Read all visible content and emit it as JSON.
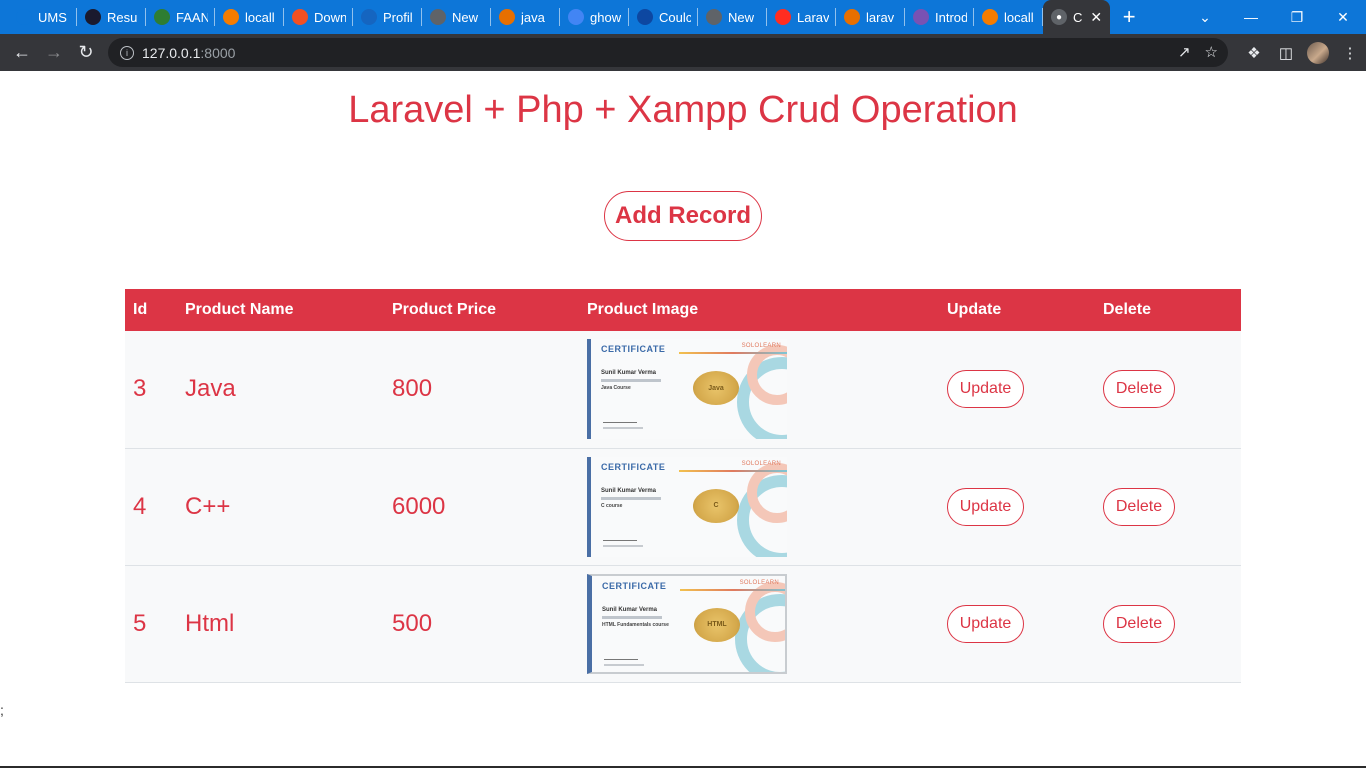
{
  "browser": {
    "tabs": [
      {
        "title": "UMS",
        "icon": "globe-icon",
        "color": "#0d76d8"
      },
      {
        "title": "Resu",
        "icon": "r-logo-icon",
        "color": "#1a1a2e"
      },
      {
        "title": "FAAN",
        "icon": "leaf-icon",
        "color": "#2e7d32"
      },
      {
        "title": "locall",
        "icon": "xampp-icon",
        "color": "#f57c00"
      },
      {
        "title": "Down",
        "icon": "windows-icon",
        "color": "#f25022"
      },
      {
        "title": "Profil",
        "icon": "k-logo-icon",
        "color": "#1565c0"
      },
      {
        "title": "New",
        "icon": "chrome-icon",
        "color": "#5f6368"
      },
      {
        "title": "java",
        "icon": "java-icon",
        "color": "#e76f00"
      },
      {
        "title": "ghow",
        "icon": "google-icon",
        "color": "#4285f4"
      },
      {
        "title": "Coulc",
        "icon": "pen-icon",
        "color": "#0d47a1"
      },
      {
        "title": "New",
        "icon": "chrome-icon",
        "color": "#5f6368"
      },
      {
        "title": "Larav",
        "icon": "laravel-icon",
        "color": "#ff2d20"
      },
      {
        "title": "larav",
        "icon": "java-icon",
        "color": "#e76f00"
      },
      {
        "title": "Introd",
        "icon": "bootstrap-icon",
        "color": "#7952b3"
      },
      {
        "title": "locall",
        "icon": "xampp-icon",
        "color": "#f57c00"
      }
    ],
    "active_tab": {
      "title": "C",
      "icon": "globe-icon"
    },
    "url_host": "127.0.0.1",
    "url_port": ":8000"
  },
  "page": {
    "title": "Laravel + Php + Xampp Crud Operation",
    "add_button": "Add Record",
    "stray_text": ";"
  },
  "table": {
    "headers": {
      "id": "Id",
      "name": "Product Name",
      "price": "Product Price",
      "image": "Product Image",
      "update": "Update",
      "delete": "Delete"
    },
    "rows": [
      {
        "id": "3",
        "name": "Java",
        "price": "800",
        "cert_title": "CERTIFICATE",
        "cert_brand": "SOLOLEARN",
        "cert_name": "Sunil Kumar Verma",
        "cert_course": "Java Course",
        "cert_seal": "Java",
        "update": "Update",
        "delete": "Delete"
      },
      {
        "id": "4",
        "name": "C++",
        "price": "6000",
        "cert_title": "CERTIFICATE",
        "cert_brand": "SOLOLEARN",
        "cert_name": "Sunil Kumar Verma",
        "cert_course": "C course",
        "cert_seal": "C",
        "update": "Update",
        "delete": "Delete"
      },
      {
        "id": "5",
        "name": "Html",
        "price": "500",
        "cert_title": "CERTIFICATE",
        "cert_brand": "SOLOLEARN",
        "cert_name": "Sunil Kumar Verma",
        "cert_course": "HTML Fundamentals course",
        "cert_seal": "HTML",
        "update": "Update",
        "delete": "Delete"
      }
    ]
  },
  "colors": {
    "accent": "#dc3545",
    "tabstrip": "#0d76d8",
    "toolbar": "#35363a"
  }
}
